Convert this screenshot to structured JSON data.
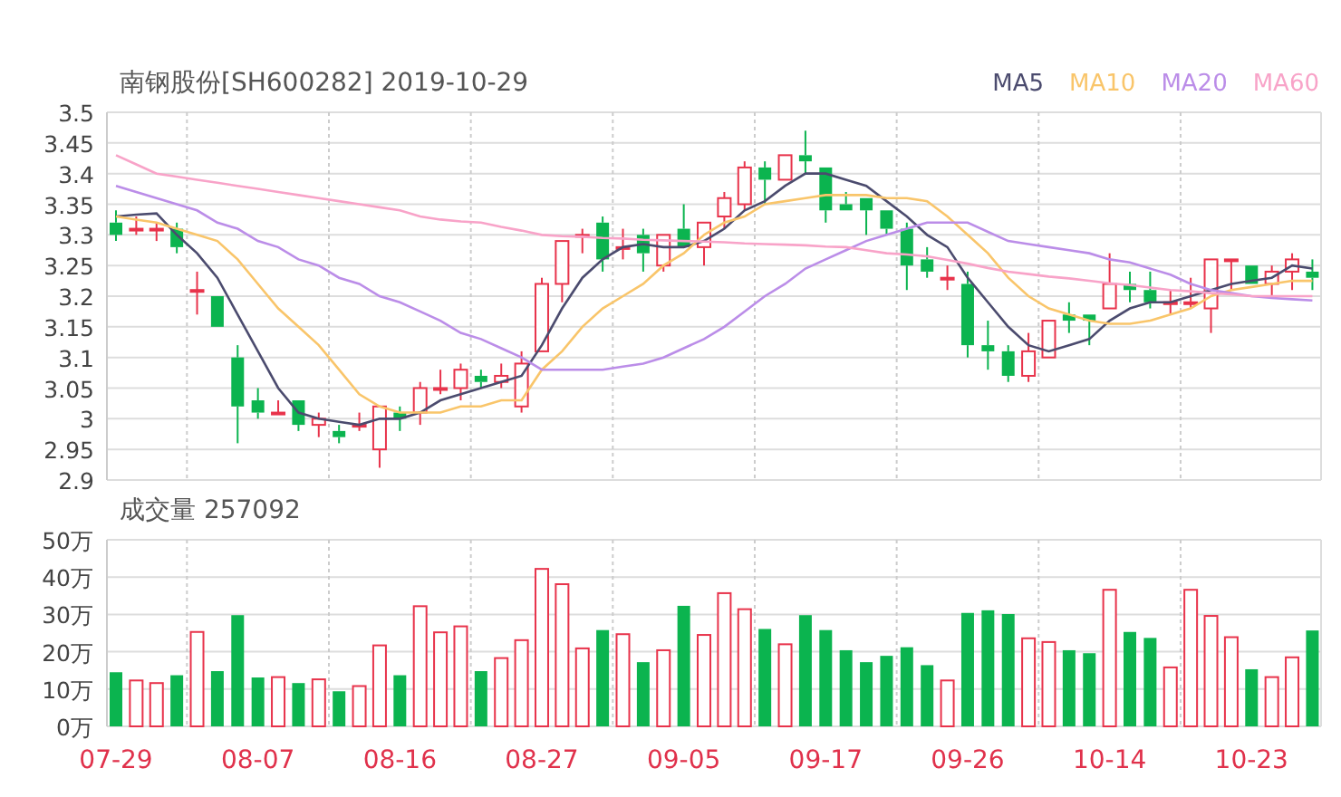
{
  "price": {
    "chart_data": {
      "type": "candlestick",
      "title": "南钢股份[SH600282] 2019-10-29",
      "grid": true,
      "ylim": [
        2.9,
        3.5
      ],
      "yticks": [
        3.5,
        3.45,
        3.4,
        3.35,
        3.3,
        3.25,
        3.2,
        3.15,
        3.1,
        3.05,
        3,
        2.95,
        2.9
      ],
      "ohlc": [
        [
          3.32,
          3.34,
          3.29,
          3.3
        ],
        [
          3.31,
          3.33,
          3.3,
          3.31
        ],
        [
          3.31,
          3.32,
          3.29,
          3.31
        ],
        [
          3.31,
          3.32,
          3.27,
          3.28
        ],
        [
          3.21,
          3.24,
          3.17,
          3.21
        ],
        [
          3.2,
          3.2,
          3.15,
          3.15
        ],
        [
          3.1,
          3.12,
          2.96,
          3.02
        ],
        [
          3.03,
          3.05,
          3.0,
          3.01
        ],
        [
          3.01,
          3.03,
          3.01,
          3.01
        ],
        [
          3.03,
          3.03,
          2.98,
          2.99
        ],
        [
          2.99,
          3.01,
          2.97,
          3.0
        ],
        [
          2.98,
          2.99,
          2.96,
          2.97
        ],
        [
          2.99,
          3.01,
          2.98,
          2.99
        ],
        [
          2.95,
          3.02,
          2.92,
          3.02
        ],
        [
          3.01,
          3.02,
          2.98,
          3.0
        ],
        [
          3.01,
          3.06,
          2.99,
          3.05
        ],
        [
          3.05,
          3.08,
          3.04,
          3.05
        ],
        [
          3.05,
          3.09,
          3.03,
          3.08
        ],
        [
          3.07,
          3.08,
          3.05,
          3.06
        ],
        [
          3.06,
          3.09,
          3.05,
          3.07
        ],
        [
          3.02,
          3.11,
          3.01,
          3.09
        ],
        [
          3.11,
          3.23,
          3.11,
          3.22
        ],
        [
          3.22,
          3.29,
          3.19,
          3.29
        ],
        [
          3.3,
          3.31,
          3.27,
          3.3
        ],
        [
          3.32,
          3.33,
          3.24,
          3.26
        ],
        [
          3.28,
          3.31,
          3.26,
          3.28
        ],
        [
          3.3,
          3.31,
          3.24,
          3.27
        ],
        [
          3.25,
          3.3,
          3.24,
          3.3
        ],
        [
          3.31,
          3.35,
          3.28,
          3.28
        ],
        [
          3.28,
          3.32,
          3.25,
          3.32
        ],
        [
          3.33,
          3.37,
          3.31,
          3.36
        ],
        [
          3.35,
          3.42,
          3.34,
          3.41
        ],
        [
          3.41,
          3.42,
          3.35,
          3.39
        ],
        [
          3.39,
          3.43,
          3.39,
          3.43
        ],
        [
          3.43,
          3.47,
          3.4,
          3.42
        ],
        [
          3.41,
          3.41,
          3.32,
          3.34
        ],
        [
          3.35,
          3.37,
          3.34,
          3.34
        ],
        [
          3.36,
          3.36,
          3.3,
          3.34
        ],
        [
          3.34,
          3.34,
          3.3,
          3.31
        ],
        [
          3.31,
          3.32,
          3.21,
          3.25
        ],
        [
          3.26,
          3.28,
          3.23,
          3.24
        ],
        [
          3.23,
          3.25,
          3.21,
          3.23
        ],
        [
          3.22,
          3.24,
          3.1,
          3.12
        ],
        [
          3.12,
          3.16,
          3.08,
          3.11
        ],
        [
          3.11,
          3.12,
          3.06,
          3.07
        ],
        [
          3.07,
          3.14,
          3.06,
          3.11
        ],
        [
          3.1,
          3.16,
          3.1,
          3.16
        ],
        [
          3.17,
          3.19,
          3.14,
          3.16
        ],
        [
          3.17,
          3.17,
          3.12,
          3.16
        ],
        [
          3.18,
          3.27,
          3.18,
          3.22
        ],
        [
          3.22,
          3.24,
          3.19,
          3.21
        ],
        [
          3.21,
          3.24,
          3.18,
          3.19
        ],
        [
          3.19,
          3.21,
          3.17,
          3.19
        ],
        [
          3.19,
          3.23,
          3.18,
          3.19
        ],
        [
          3.18,
          3.26,
          3.14,
          3.26
        ],
        [
          3.26,
          3.26,
          3.21,
          3.26
        ],
        [
          3.25,
          3.25,
          3.22,
          3.22
        ],
        [
          3.22,
          3.25,
          3.2,
          3.24
        ],
        [
          3.24,
          3.27,
          3.21,
          3.26
        ],
        [
          3.24,
          3.26,
          3.21,
          3.23
        ]
      ],
      "series": [
        {
          "type": "line",
          "name": "MA5",
          "color": "#4b4b6e",
          "values": [
            3.33,
            3.333,
            3.335,
            3.3,
            3.27,
            3.23,
            3.17,
            3.11,
            3.05,
            3.01,
            3.0,
            2.995,
            2.99,
            3.0,
            3.0,
            3.01,
            3.03,
            3.04,
            3.05,
            3.06,
            3.07,
            3.12,
            3.18,
            3.23,
            3.26,
            3.28,
            3.285,
            3.28,
            3.28,
            3.29,
            3.31,
            3.34,
            3.355,
            3.38,
            3.4,
            3.4,
            3.39,
            3.38,
            3.355,
            3.33,
            3.3,
            3.28,
            3.23,
            3.19,
            3.15,
            3.12,
            3.11,
            3.12,
            3.13,
            3.16,
            3.18,
            3.19,
            3.19,
            3.2,
            3.21,
            3.22,
            3.225,
            3.23,
            3.25,
            3.245
          ]
        },
        {
          "type": "line",
          "name": "MA10",
          "color": "#f9c56a",
          "values": [
            3.33,
            3.325,
            3.32,
            3.31,
            3.3,
            3.29,
            3.26,
            3.22,
            3.18,
            3.15,
            3.12,
            3.08,
            3.04,
            3.02,
            3.01,
            3.01,
            3.01,
            3.02,
            3.02,
            3.03,
            3.03,
            3.08,
            3.11,
            3.15,
            3.18,
            3.2,
            3.22,
            3.25,
            3.27,
            3.3,
            3.32,
            3.33,
            3.35,
            3.355,
            3.36,
            3.365,
            3.365,
            3.365,
            3.36,
            3.36,
            3.355,
            3.33,
            3.3,
            3.27,
            3.23,
            3.2,
            3.18,
            3.17,
            3.16,
            3.155,
            3.155,
            3.16,
            3.17,
            3.18,
            3.2,
            3.21,
            3.215,
            3.22,
            3.225,
            3.225
          ]
        },
        {
          "type": "line",
          "name": "MA20",
          "color": "#bb8de8",
          "values": [
            3.38,
            3.37,
            3.36,
            3.35,
            3.34,
            3.32,
            3.31,
            3.29,
            3.28,
            3.26,
            3.25,
            3.23,
            3.22,
            3.2,
            3.19,
            3.175,
            3.16,
            3.14,
            3.13,
            3.115,
            3.1,
            3.08,
            3.08,
            3.08,
            3.08,
            3.085,
            3.09,
            3.1,
            3.115,
            3.13,
            3.15,
            3.175,
            3.2,
            3.22,
            3.245,
            3.26,
            3.275,
            3.29,
            3.3,
            3.31,
            3.32,
            3.32,
            3.32,
            3.305,
            3.29,
            3.285,
            3.28,
            3.275,
            3.27,
            3.26,
            3.255,
            3.245,
            3.235,
            3.22,
            3.21,
            3.205,
            3.2,
            3.197,
            3.195,
            3.193
          ]
        },
        {
          "type": "line",
          "name": "MA60",
          "color": "#f8a3c8",
          "values": [
            3.43,
            3.415,
            3.4,
            3.395,
            3.39,
            3.385,
            3.38,
            3.375,
            3.37,
            3.365,
            3.36,
            3.355,
            3.35,
            3.345,
            3.34,
            3.33,
            3.325,
            3.322,
            3.32,
            3.313,
            3.307,
            3.3,
            3.298,
            3.297,
            3.295,
            3.294,
            3.292,
            3.291,
            3.29,
            3.289,
            3.288,
            3.286,
            3.285,
            3.284,
            3.283,
            3.281,
            3.28,
            3.275,
            3.27,
            3.268,
            3.265,
            3.259,
            3.253,
            3.246,
            3.24,
            3.236,
            3.232,
            3.229,
            3.225,
            3.221,
            3.218,
            3.214,
            3.21,
            3.208,
            3.205,
            3.203,
            3.2,
            3.2,
            3.2,
            3.2
          ]
        }
      ]
    }
  },
  "volume": {
    "chart_data": {
      "type": "bar",
      "title": "成交量 257092",
      "grid": true,
      "ylim": [
        0,
        50
      ],
      "yticks": [
        {
          "value": 50,
          "label": "50万"
        },
        {
          "value": 40,
          "label": "40万"
        },
        {
          "value": 30,
          "label": "30万"
        },
        {
          "value": 20,
          "label": "20万"
        },
        {
          "value": 10,
          "label": "10万"
        },
        {
          "value": 0,
          "label": "0万"
        }
      ],
      "categories": [
        "07-29",
        null,
        null,
        null,
        null,
        null,
        null,
        "08-07",
        null,
        null,
        null,
        null,
        null,
        null,
        "08-16",
        null,
        null,
        null,
        null,
        null,
        null,
        "08-27",
        null,
        null,
        null,
        null,
        null,
        null,
        "09-05",
        null,
        null,
        null,
        null,
        null,
        null,
        "09-17",
        null,
        null,
        null,
        null,
        null,
        null,
        "09-26",
        null,
        null,
        null,
        null,
        null,
        null,
        "10-14",
        null,
        null,
        null,
        null,
        null,
        null,
        "10-23",
        null,
        null,
        null
      ],
      "values": [
        14.5,
        12.3,
        11.6,
        13.7,
        25.3,
        14.8,
        29.8,
        13.1,
        13.2,
        11.6,
        12.6,
        9.4,
        10.8,
        21.7,
        13.7,
        32.2,
        25.2,
        26.8,
        14.8,
        18.3,
        23.1,
        42.2,
        38.1,
        20.9,
        25.8,
        24.7,
        17.2,
        20.4,
        32.3,
        24.5,
        35.7,
        31.4,
        26.1,
        22.0,
        29.8,
        25.8,
        20.4,
        17.2,
        18.9,
        21.2,
        16.4,
        12.3,
        30.4,
        31.1,
        30.1,
        23.6,
        22.6,
        20.4,
        19.6,
        36.6,
        25.3,
        23.7,
        15.8,
        36.6,
        29.6,
        23.9,
        15.3,
        13.2,
        18.5,
        25.7
      ]
    }
  }
}
